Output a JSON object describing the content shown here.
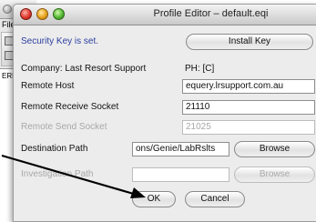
{
  "background_window": {
    "menu_label": "File",
    "list_text": "ERRC"
  },
  "dialog": {
    "title": "Profile Editor – default.eqi",
    "security_status": "Security Key is set.",
    "install_key_button": "Install Key",
    "company_label": "Company: Last Resort Support",
    "phone_label": "PH: [C]",
    "remote_host": {
      "label": "Remote Host",
      "value": "equery.lrsupport.com.au"
    },
    "remote_receive_socket": {
      "label": "Remote Receive Socket",
      "value": "21110"
    },
    "remote_send_socket": {
      "label": "Remote Send Socket",
      "value": "21025"
    },
    "destination_path": {
      "label": "Destination Path",
      "value": "ons/Genie/LabRslts",
      "browse_label": "Browse"
    },
    "investigation_path": {
      "label": "Investigation Path",
      "value": "",
      "browse_label": "Browse"
    },
    "ok_button": "OK",
    "cancel_button": "Cancel"
  },
  "colors": {
    "accent_text": "#2a3ea0",
    "disabled_text": "#a8a8a8"
  }
}
